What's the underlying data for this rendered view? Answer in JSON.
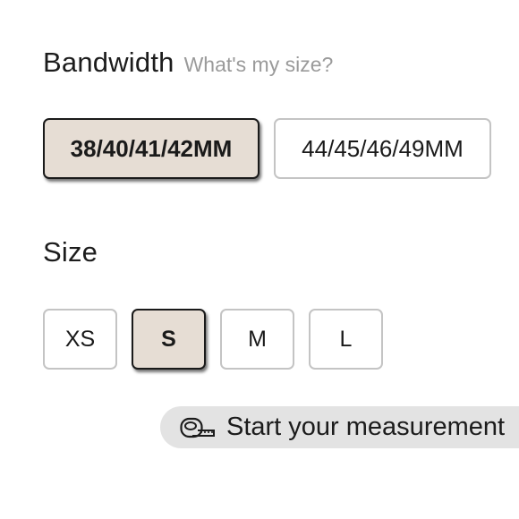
{
  "bandwidth": {
    "title": "Bandwidth",
    "help_link": "What's my size?",
    "options": [
      {
        "label": "38/40/41/42MM",
        "selected": true
      },
      {
        "label": "44/45/46/49MM",
        "selected": false
      }
    ]
  },
  "size": {
    "title": "Size",
    "options": [
      {
        "label": "XS",
        "selected": false
      },
      {
        "label": "S",
        "selected": true
      },
      {
        "label": "M",
        "selected": false
      },
      {
        "label": "L",
        "selected": false
      }
    ]
  },
  "measurement": {
    "label": "Start your measurement",
    "icon": "measuring-tape-icon"
  },
  "colors": {
    "selected_background": "#e6ddd4",
    "selected_border": "#1a1a1a",
    "default_border": "#c4c4c4",
    "pill_background": "#e3e3e3",
    "help_text": "#9a9a9a"
  }
}
